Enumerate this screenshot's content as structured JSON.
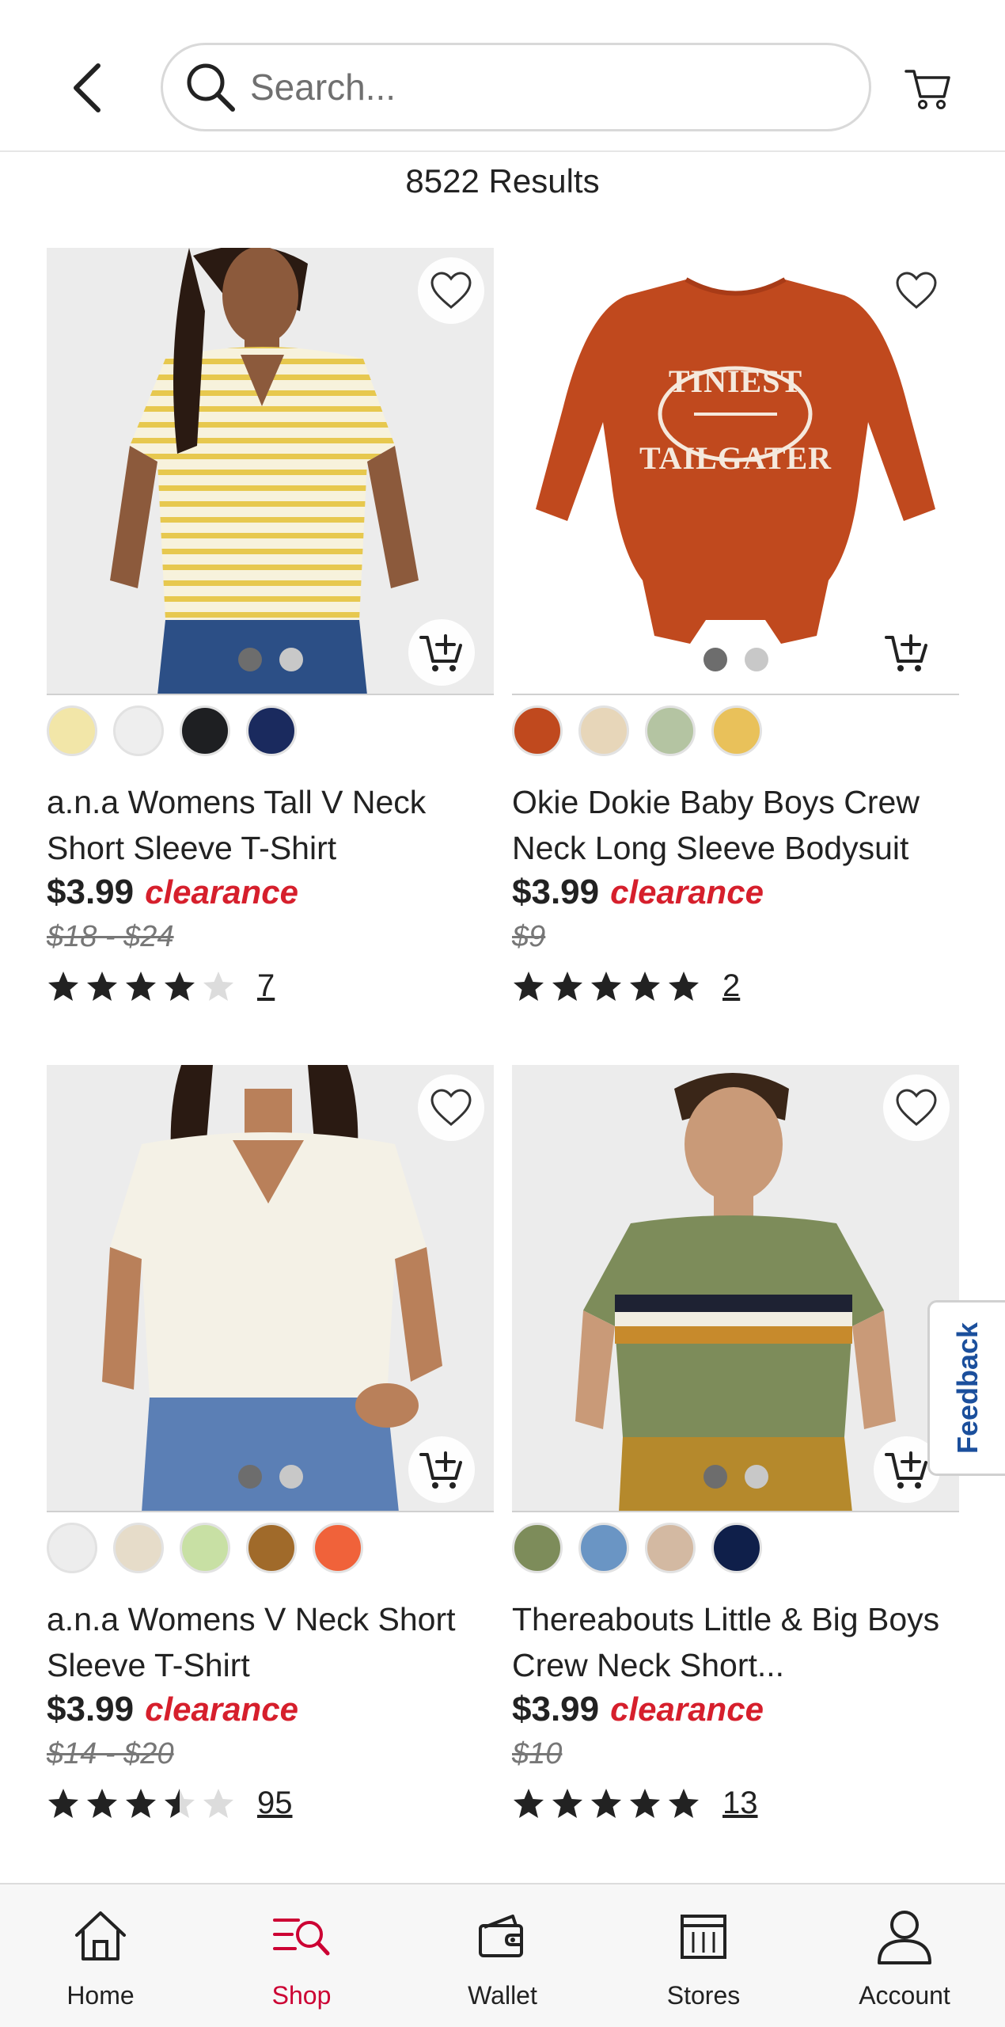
{
  "header": {
    "search_placeholder": "Search...",
    "results_text": "8522 Results"
  },
  "products": [
    {
      "title": "a.n.a Womens Tall V Neck Short Sleeve T-Shirt",
      "price": "$3.99",
      "badge": "clearance",
      "original_price": "$18 - $24",
      "rating": 4,
      "review_count": "7",
      "swatches": [
        "#f2e6a8",
        "#eeeeee",
        "#1e1f22",
        "#1a2a5e"
      ]
    },
    {
      "title": "Okie Dokie Baby Boys Crew Neck Long Sleeve Bodysuit",
      "price": "$3.99",
      "badge": "clearance",
      "original_price": "$9",
      "rating": 5,
      "review_count": "2",
      "swatches": [
        "#c0491e",
        "#e7d6b9",
        "#b4c4a2",
        "#e9c15a"
      ]
    },
    {
      "title": "a.n.a Womens V Neck Short Sleeve T-Shirt",
      "price": "$3.99",
      "badge": "clearance",
      "original_price": "$14 - $20",
      "rating": 3.5,
      "review_count": "95",
      "swatches": [
        "#ededed",
        "#e6dcc9",
        "#c8e0a4",
        "#a06a2a",
        "#f0623a"
      ]
    },
    {
      "title": "Thereabouts Little & Big Boys Crew Neck Short...",
      "price": "$3.99",
      "badge": "clearance",
      "original_price": "$10",
      "rating": 5,
      "review_count": "13",
      "swatches": [
        "#7d8c5a",
        "#6a95c4",
        "#d3b9a2",
        "#0f1f4a"
      ]
    }
  ],
  "feedback_label": "Feedback",
  "nav": {
    "items": [
      {
        "label": "Home",
        "icon": "home-icon"
      },
      {
        "label": "Shop",
        "icon": "shop-icon"
      },
      {
        "label": "Wallet",
        "icon": "wallet-icon"
      },
      {
        "label": "Stores",
        "icon": "stores-icon"
      },
      {
        "label": "Account",
        "icon": "account-icon"
      }
    ],
    "active": "Shop"
  },
  "colors": {
    "clearance": "#d61f2c",
    "nav_active": "#cc0033",
    "feedback": "#1b4f9c"
  }
}
